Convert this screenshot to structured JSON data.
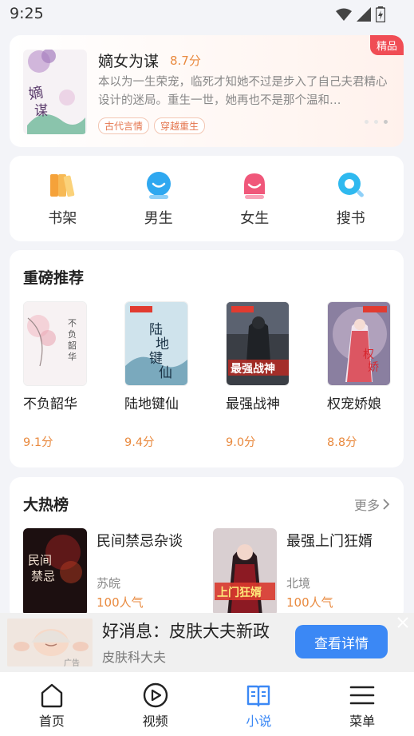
{
  "status": {
    "time": "9:25"
  },
  "featured": {
    "title": "嫡女为谋",
    "score": "8.7分",
    "description": "本以为一生荣宠，临死才知她不过是步入了自己夫君精心设计的迷局。重生一世，她再也不是那个温和…",
    "tags": [
      "古代言情",
      "穿越重生"
    ],
    "badge": "精品",
    "cover_text": "嫡女为谋"
  },
  "nav": [
    {
      "label": "书架",
      "icon": "bookshelf-icon"
    },
    {
      "label": "男生",
      "icon": "male-icon"
    },
    {
      "label": "女生",
      "icon": "female-icon"
    },
    {
      "label": "搜书",
      "icon": "search-book-icon"
    }
  ],
  "recommend": {
    "title": "重磅推荐",
    "books": [
      {
        "name": "不负韶华",
        "score": "9.1分",
        "cover_text": "不负韶华"
      },
      {
        "name": "陆地键仙",
        "score": "9.4分",
        "cover_text": "陆地键仙"
      },
      {
        "name": "最强战神",
        "score": "9.0分",
        "cover_text": "最强战神"
      },
      {
        "name": "权宠娇娘",
        "score": "8.8分",
        "cover_text": "权宠娇娘"
      }
    ]
  },
  "hot": {
    "title": "大热榜",
    "more": "更多",
    "books": [
      {
        "name": "民间禁忌杂谈",
        "author": "苏皖",
        "popularity": "100人气",
        "cover_text": "民间禁忌"
      },
      {
        "name": "最强上门狂婿",
        "author": "北境",
        "popularity": "100人气",
        "cover_text": "上门狂婿"
      }
    ]
  },
  "ad": {
    "title": "好消息：皮肤大夫新政",
    "subtitle": "皮肤科大夫",
    "label": "广告",
    "button": "查看详情"
  },
  "bottom_nav": [
    {
      "label": "首页",
      "icon": "home-icon",
      "active": false
    },
    {
      "label": "视频",
      "icon": "video-icon",
      "active": false
    },
    {
      "label": "小说",
      "icon": "novel-icon",
      "active": true
    },
    {
      "label": "菜单",
      "icon": "menu-icon",
      "active": false
    }
  ],
  "colors": {
    "accent": "#3b88f5",
    "score": "#e98a3f",
    "badge": "#f04d55"
  }
}
